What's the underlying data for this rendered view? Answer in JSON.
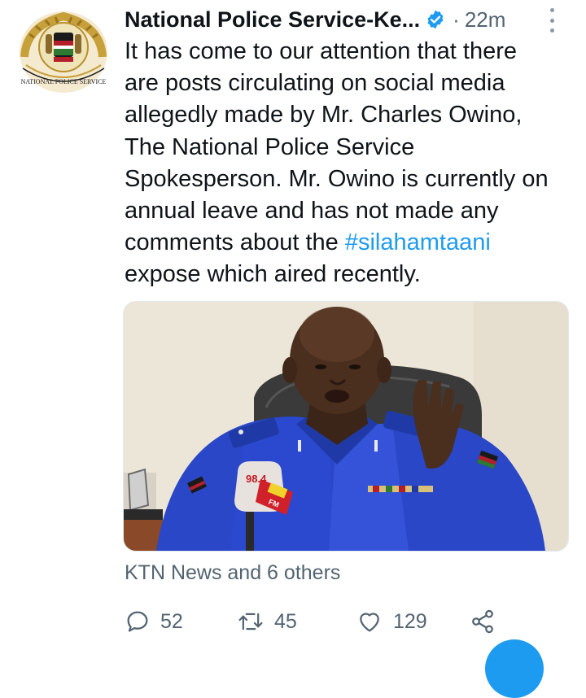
{
  "tweet": {
    "author_name": "National Police Service-Ke...",
    "separator": "·",
    "timestamp": "22m",
    "text_lines": [
      "It has come to our attention that there",
      "are posts circulating on social media",
      "allegedly made by Mr. Charles Owino,",
      "The National Police Service",
      "Spokesperson. Mr. Owino is currently on",
      "annual leave and has not made any"
    ],
    "text_line7_prefix": "comments about the ",
    "hashtag": "#silahamtaani",
    "text_line8": "expose which aired recently.",
    "media_labels": {
      "mic_flag": "98.4",
      "mic_flag_text": "FM"
    },
    "avatar_seal_text": "NATIONAL POLICE SERVICE",
    "engagement_text": "KTN News and 6 others"
  },
  "actions": {
    "reply_count": "52",
    "retweet_count": "45",
    "like_count": "129"
  },
  "icons": {
    "verified": "verified-badge-icon",
    "more": "more-vertical-icon",
    "reply": "reply-icon",
    "retweet": "retweet-icon",
    "like": "heart-icon",
    "share": "share-icon"
  },
  "colors": {
    "accent": "#1d9bf0",
    "text": "#0f1419",
    "muted": "#536471",
    "seal_gold": "#c8a03a"
  }
}
